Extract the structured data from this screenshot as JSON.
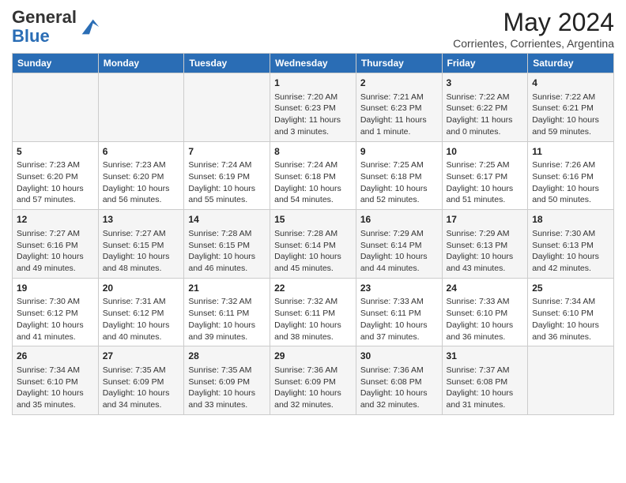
{
  "header": {
    "logo_general": "General",
    "logo_blue": "Blue",
    "month_title": "May 2024",
    "subtitle": "Corrientes, Corrientes, Argentina"
  },
  "days_of_week": [
    "Sunday",
    "Monday",
    "Tuesday",
    "Wednesday",
    "Thursday",
    "Friday",
    "Saturday"
  ],
  "weeks": [
    [
      {
        "day": "",
        "info": ""
      },
      {
        "day": "",
        "info": ""
      },
      {
        "day": "",
        "info": ""
      },
      {
        "day": "1",
        "info": "Sunrise: 7:20 AM\nSunset: 6:23 PM\nDaylight: 11 hours\nand 3 minutes."
      },
      {
        "day": "2",
        "info": "Sunrise: 7:21 AM\nSunset: 6:23 PM\nDaylight: 11 hours\nand 1 minute."
      },
      {
        "day": "3",
        "info": "Sunrise: 7:22 AM\nSunset: 6:22 PM\nDaylight: 11 hours\nand 0 minutes."
      },
      {
        "day": "4",
        "info": "Sunrise: 7:22 AM\nSunset: 6:21 PM\nDaylight: 10 hours\nand 59 minutes."
      }
    ],
    [
      {
        "day": "5",
        "info": "Sunrise: 7:23 AM\nSunset: 6:20 PM\nDaylight: 10 hours\nand 57 minutes."
      },
      {
        "day": "6",
        "info": "Sunrise: 7:23 AM\nSunset: 6:20 PM\nDaylight: 10 hours\nand 56 minutes."
      },
      {
        "day": "7",
        "info": "Sunrise: 7:24 AM\nSunset: 6:19 PM\nDaylight: 10 hours\nand 55 minutes."
      },
      {
        "day": "8",
        "info": "Sunrise: 7:24 AM\nSunset: 6:18 PM\nDaylight: 10 hours\nand 54 minutes."
      },
      {
        "day": "9",
        "info": "Sunrise: 7:25 AM\nSunset: 6:18 PM\nDaylight: 10 hours\nand 52 minutes."
      },
      {
        "day": "10",
        "info": "Sunrise: 7:25 AM\nSunset: 6:17 PM\nDaylight: 10 hours\nand 51 minutes."
      },
      {
        "day": "11",
        "info": "Sunrise: 7:26 AM\nSunset: 6:16 PM\nDaylight: 10 hours\nand 50 minutes."
      }
    ],
    [
      {
        "day": "12",
        "info": "Sunrise: 7:27 AM\nSunset: 6:16 PM\nDaylight: 10 hours\nand 49 minutes."
      },
      {
        "day": "13",
        "info": "Sunrise: 7:27 AM\nSunset: 6:15 PM\nDaylight: 10 hours\nand 48 minutes."
      },
      {
        "day": "14",
        "info": "Sunrise: 7:28 AM\nSunset: 6:15 PM\nDaylight: 10 hours\nand 46 minutes."
      },
      {
        "day": "15",
        "info": "Sunrise: 7:28 AM\nSunset: 6:14 PM\nDaylight: 10 hours\nand 45 minutes."
      },
      {
        "day": "16",
        "info": "Sunrise: 7:29 AM\nSunset: 6:14 PM\nDaylight: 10 hours\nand 44 minutes."
      },
      {
        "day": "17",
        "info": "Sunrise: 7:29 AM\nSunset: 6:13 PM\nDaylight: 10 hours\nand 43 minutes."
      },
      {
        "day": "18",
        "info": "Sunrise: 7:30 AM\nSunset: 6:13 PM\nDaylight: 10 hours\nand 42 minutes."
      }
    ],
    [
      {
        "day": "19",
        "info": "Sunrise: 7:30 AM\nSunset: 6:12 PM\nDaylight: 10 hours\nand 41 minutes."
      },
      {
        "day": "20",
        "info": "Sunrise: 7:31 AM\nSunset: 6:12 PM\nDaylight: 10 hours\nand 40 minutes."
      },
      {
        "day": "21",
        "info": "Sunrise: 7:32 AM\nSunset: 6:11 PM\nDaylight: 10 hours\nand 39 minutes."
      },
      {
        "day": "22",
        "info": "Sunrise: 7:32 AM\nSunset: 6:11 PM\nDaylight: 10 hours\nand 38 minutes."
      },
      {
        "day": "23",
        "info": "Sunrise: 7:33 AM\nSunset: 6:11 PM\nDaylight: 10 hours\nand 37 minutes."
      },
      {
        "day": "24",
        "info": "Sunrise: 7:33 AM\nSunset: 6:10 PM\nDaylight: 10 hours\nand 36 minutes."
      },
      {
        "day": "25",
        "info": "Sunrise: 7:34 AM\nSunset: 6:10 PM\nDaylight: 10 hours\nand 36 minutes."
      }
    ],
    [
      {
        "day": "26",
        "info": "Sunrise: 7:34 AM\nSunset: 6:10 PM\nDaylight: 10 hours\nand 35 minutes."
      },
      {
        "day": "27",
        "info": "Sunrise: 7:35 AM\nSunset: 6:09 PM\nDaylight: 10 hours\nand 34 minutes."
      },
      {
        "day": "28",
        "info": "Sunrise: 7:35 AM\nSunset: 6:09 PM\nDaylight: 10 hours\nand 33 minutes."
      },
      {
        "day": "29",
        "info": "Sunrise: 7:36 AM\nSunset: 6:09 PM\nDaylight: 10 hours\nand 32 minutes."
      },
      {
        "day": "30",
        "info": "Sunrise: 7:36 AM\nSunset: 6:08 PM\nDaylight: 10 hours\nand 32 minutes."
      },
      {
        "day": "31",
        "info": "Sunrise: 7:37 AM\nSunset: 6:08 PM\nDaylight: 10 hours\nand 31 minutes."
      },
      {
        "day": "",
        "info": ""
      }
    ]
  ]
}
